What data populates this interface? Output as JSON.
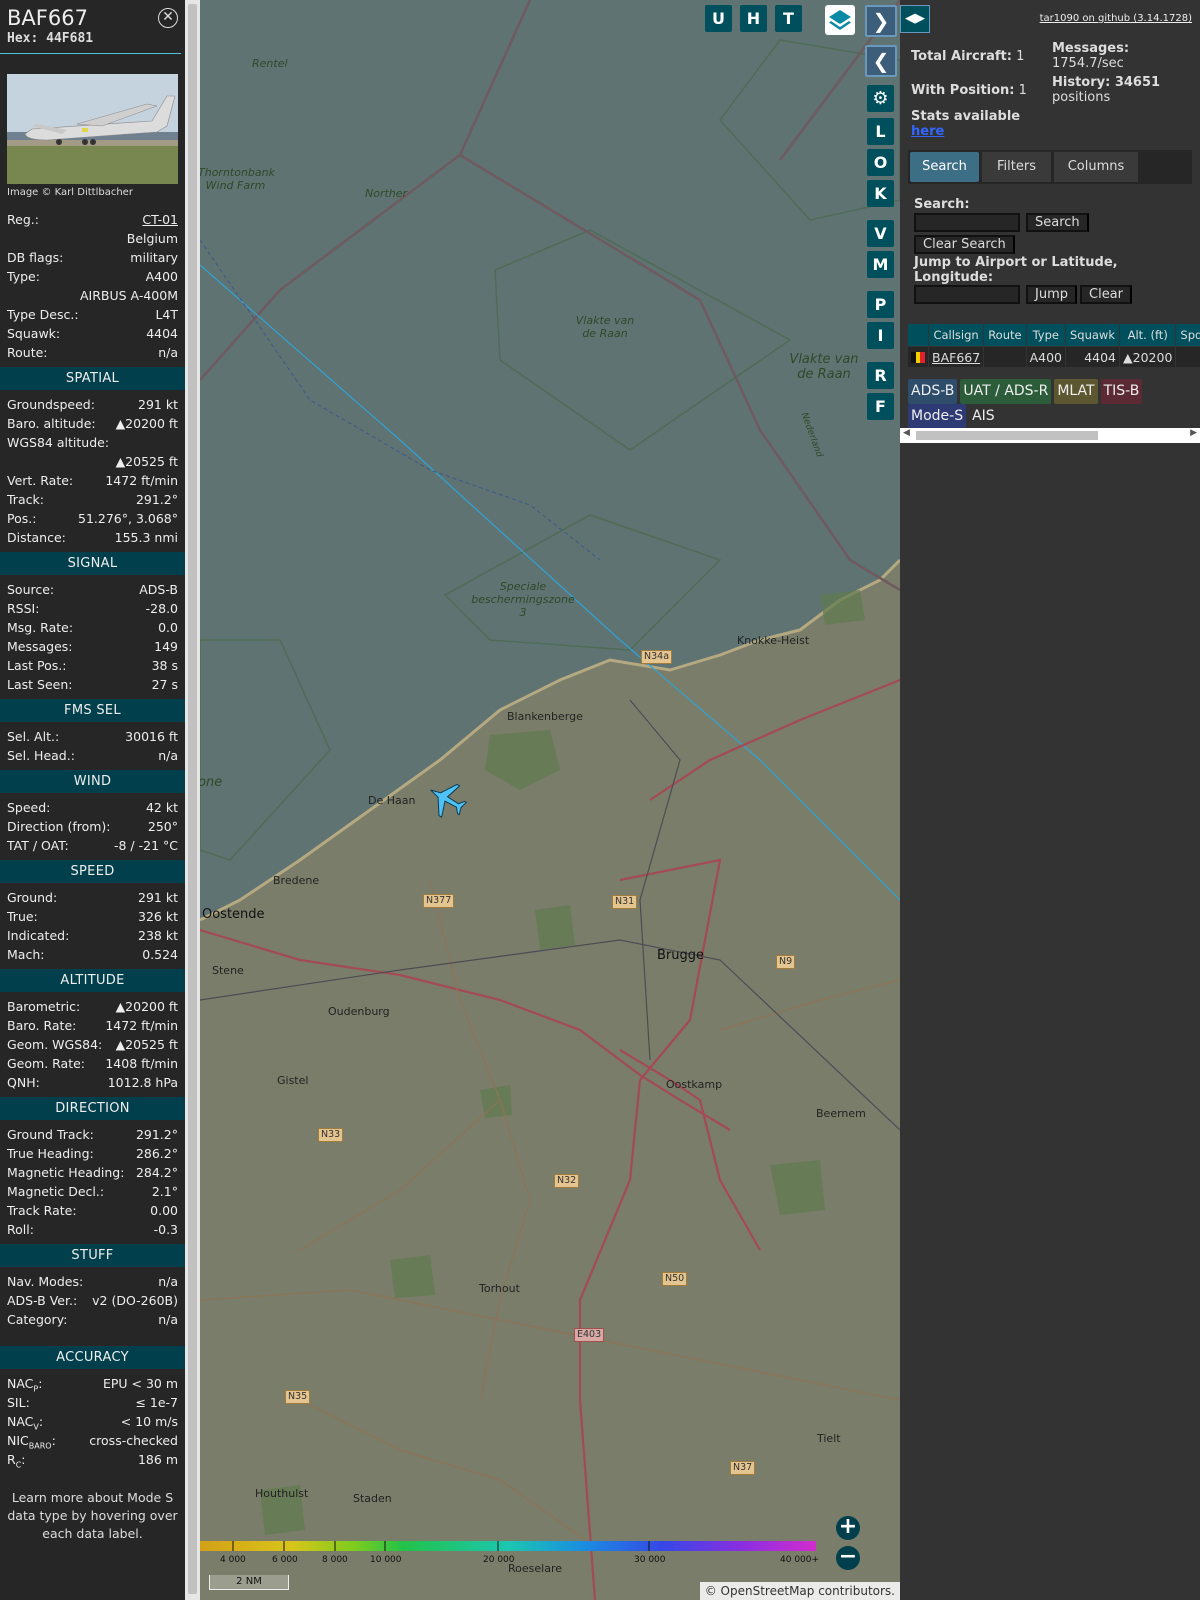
{
  "selected": {
    "callsign": "BAF667",
    "hex": "Hex: 44F681",
    "photo_credit": "Image © Karl Dittlbacher",
    "info": [
      {
        "k": "Reg.:",
        "v": "CT-01",
        "link": true
      },
      {
        "k": "",
        "v": "Belgium"
      },
      {
        "k": "DB flags:",
        "v": "military"
      },
      {
        "k": "Type:",
        "v": "A400"
      },
      {
        "k": "",
        "v": "AIRBUS A-400M"
      },
      {
        "k": "Type Desc.:",
        "v": "L4T"
      },
      {
        "k": "Squawk:",
        "v": "4404"
      },
      {
        "k": "Route:",
        "v": "n/a"
      }
    ],
    "sections": [
      {
        "title": "SPATIAL",
        "rows": [
          {
            "k": "Groundspeed:",
            "v": "291 kt"
          },
          {
            "k": "Baro. altitude:",
            "v": "▲20200 ft"
          },
          {
            "k": "WGS84 altitude:",
            "v": ""
          },
          {
            "k": "",
            "v": "▲20525 ft"
          },
          {
            "k": "Vert. Rate:",
            "v": "1472 ft/min"
          },
          {
            "k": "Track:",
            "v": "291.2°"
          },
          {
            "k": "Pos.:",
            "v": "51.276°, 3.068°"
          },
          {
            "k": "Distance:",
            "v": "155.3 nmi"
          }
        ]
      },
      {
        "title": "SIGNAL",
        "rows": [
          {
            "k": "Source:",
            "v": "ADS-B"
          },
          {
            "k": "RSSI:",
            "v": "-28.0"
          },
          {
            "k": "Msg. Rate:",
            "v": "0.0"
          },
          {
            "k": "Messages:",
            "v": "149"
          },
          {
            "k": "Last Pos.:",
            "v": "38 s"
          },
          {
            "k": "Last Seen:",
            "v": "27 s"
          }
        ]
      },
      {
        "title": "FMS SEL",
        "rows": [
          {
            "k": "Sel. Alt.:",
            "v": "30016 ft"
          },
          {
            "k": "Sel. Head.:",
            "v": "n/a"
          }
        ]
      },
      {
        "title": "WIND",
        "rows": [
          {
            "k": "Speed:",
            "v": "42 kt"
          },
          {
            "k": "Direction (from):",
            "v": "250°"
          },
          {
            "k": "TAT / OAT:",
            "v": "-8 / -21 °C"
          }
        ]
      },
      {
        "title": "SPEED",
        "rows": [
          {
            "k": "Ground:",
            "v": "291 kt"
          },
          {
            "k": "True:",
            "v": "326 kt"
          },
          {
            "k": "Indicated:",
            "v": "238 kt"
          },
          {
            "k": "Mach:",
            "v": "0.524"
          }
        ]
      },
      {
        "title": "ALTITUDE",
        "rows": [
          {
            "k": "Barometric:",
            "v": "▲20200 ft"
          },
          {
            "k": "Baro. Rate:",
            "v": "1472 ft/min"
          },
          {
            "k": "Geom. WGS84:",
            "v": "▲20525 ft"
          },
          {
            "k": "Geom. Rate:",
            "v": "1408 ft/min"
          },
          {
            "k": "QNH:",
            "v": "1012.8 hPa"
          }
        ]
      },
      {
        "title": "DIRECTION",
        "rows": [
          {
            "k": "Ground Track:",
            "v": "291.2°"
          },
          {
            "k": "True Heading:",
            "v": "286.2°"
          },
          {
            "k": "Magnetic Heading:",
            "v": "284.2°"
          },
          {
            "k": "Magnetic Decl.:",
            "v": "2.1°"
          },
          {
            "k": "Track Rate:",
            "v": "0.00"
          },
          {
            "k": "Roll:",
            "v": "-0.3"
          }
        ]
      },
      {
        "title": "STUFF",
        "rows": [
          {
            "k": "Nav. Modes:",
            "v": "n/a"
          },
          {
            "k": "ADS-B Ver.:",
            "v": "v2 (DO-260B)"
          },
          {
            "k": "Category:",
            "v": "n/a"
          }
        ]
      }
    ],
    "accuracy": {
      "title": "ACCURACY",
      "rows": [
        {
          "k": "NAC",
          "sub": "P",
          "v": "EPU < 30 m"
        },
        {
          "k": "SIL:",
          "sub": "",
          "v": "≤ 1e-7"
        },
        {
          "k": "NAC",
          "sub": "V",
          "v": "< 10 m/s"
        },
        {
          "k": "NIC",
          "sub": "BARO",
          "v": "cross-checked"
        },
        {
          "k": "R",
          "sub": "C",
          "v": "186 m"
        }
      ]
    },
    "learn_more": "Learn more about Mode S data type by hovering over each data label."
  },
  "map": {
    "buttons_top": [
      "U",
      "H",
      "T"
    ],
    "buttons_side": [
      "L",
      "O",
      "K",
      "V",
      "M",
      "P",
      "I",
      "R",
      "F"
    ],
    "labels": {
      "rentel": "Rentel",
      "thorntonbank": "Thorntonbank Wind Farm",
      "norther": "Norther",
      "vlakte1": "Vlakte van de Raan",
      "vlakte2": "Vlakte van de Raan",
      "nederland": "Nederland",
      "speciale": "Speciale beschermingszone 3",
      "knokke": "Knokke-Heist",
      "blankenberge": "Blankenberge",
      "dehaan": "De Haan",
      "bredene": "Bredene",
      "oostende": "Oostende",
      "stene": "Stene",
      "brugge": "Brugge",
      "oudenburg": "Oudenburg",
      "gistel": "Gistel",
      "oostkamp": "Oostkamp",
      "beernem": "Beernem",
      "torhout": "Torhout",
      "tielt": "Tielt",
      "houthulst": "Houthulst",
      "staden": "Staden",
      "roeselare": "Roeselare",
      "zone": "one"
    },
    "shields": [
      "N34a",
      "N377",
      "N31",
      "N9",
      "N33",
      "N32",
      "N50",
      "E403",
      "N35",
      "N37"
    ],
    "scale_labels": [
      "4 000",
      "6 000",
      "8 000",
      "10 000",
      "20 000",
      "30 000",
      "40 000+"
    ],
    "scale_distance": "2 NM",
    "attribution": "© OpenStreetMap contributors."
  },
  "side": {
    "github": "tar1090 on github (3.14.1728)",
    "total_aircraft_label": "Total Aircraft:",
    "total_aircraft": "1",
    "with_position_label": "With Position:",
    "with_position": "1",
    "stats_label": "Stats available",
    "stats_link": "here",
    "messages_label": "Messages:",
    "messages_rate": "1754.7/sec",
    "history_label": "History: 34651",
    "history_unit": "positions",
    "tabs": [
      "Search",
      "Filters",
      "Columns"
    ],
    "search_label": "Search:",
    "search_button": "Search",
    "clear_search_button": "Clear Search",
    "jump_label": "Jump to Airport or Latitude, Longitude:",
    "jump_button": "Jump",
    "clear_button": "Clear",
    "table_headers": [
      "",
      "Callsign",
      "Route",
      "Type",
      "Squawk",
      "Alt. (ft)",
      "Spd"
    ],
    "table_rows": [
      {
        "flag": "BE",
        "callsign": "BAF667",
        "route": "",
        "type": "A400",
        "squawk": "4404",
        "alt": "▲20200",
        "spd": ""
      }
    ],
    "source_chips": [
      {
        "label": "ADS-B",
        "bg": "#2d4d6b",
        "fg": "#eee"
      },
      {
        "label": "UAT / ADS-R",
        "bg": "#2c5c3a",
        "fg": "#eee"
      },
      {
        "label": "MLAT",
        "bg": "#5c5730",
        "fg": "#eee"
      },
      {
        "label": "TIS-B",
        "bg": "#5c2a34",
        "fg": "#eee"
      },
      {
        "label": "Mode-S",
        "bg": "#2e3a73",
        "fg": "#eee"
      },
      {
        "label": "AIS",
        "bg": "transparent",
        "fg": "#eee"
      }
    ]
  },
  "colors": {
    "panel_bg": "#262626",
    "section_bg": "#003f4b",
    "button_bg": "#004f5d",
    "aircraft": "#4fc3f7"
  }
}
